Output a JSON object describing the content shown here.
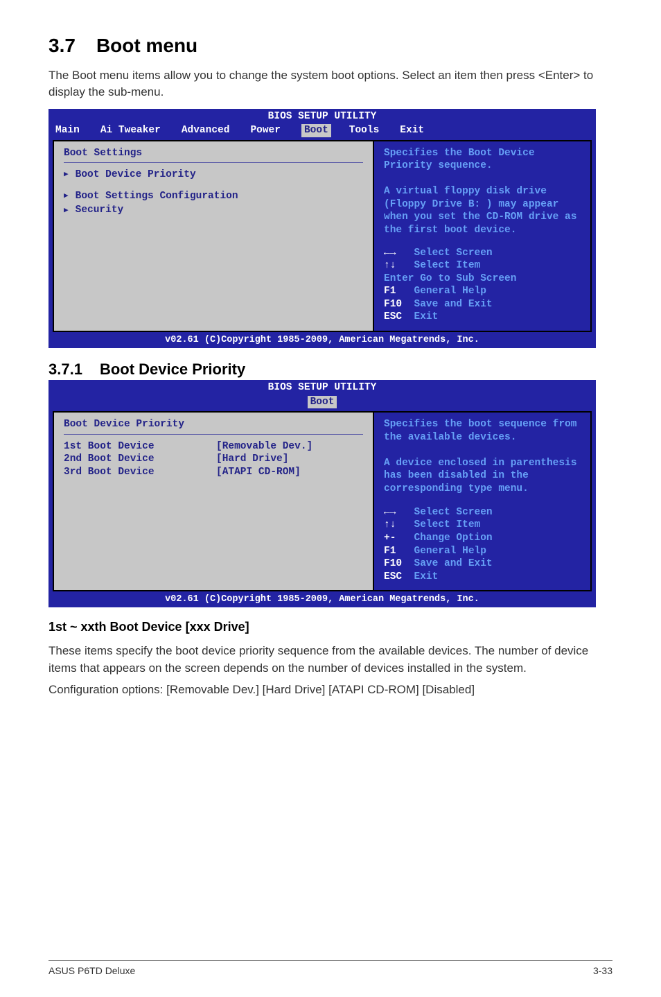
{
  "heading": {
    "num": "3.7",
    "title": "Boot menu"
  },
  "intro": "The Boot menu items allow you to change the system boot options. Select an item then press <Enter> to display the sub-menu.",
  "bios1": {
    "title": "BIOS SETUP UTILITY",
    "menubar": [
      "Main",
      "Ai Tweaker",
      "Advanced",
      "Power",
      "Boot",
      "Tools",
      "Exit"
    ],
    "active": 4,
    "panel_title": "Boot Settings",
    "items": [
      "Boot Device Priority",
      "Boot Settings Configuration",
      "Security"
    ],
    "help": "Specifies the Boot Device Priority sequence.\n\nA virtual floppy disk drive (Floppy Drive B: ) may appear when you set the CD-ROM drive as the first boot device.",
    "legend": {
      "arrows": "Select Screen",
      "updown": "Select Item",
      "enter": "Enter Go to Sub Screen",
      "f1": {
        "key": "F1",
        "label": "General Help"
      },
      "f10": {
        "key": "F10",
        "label": "Save and Exit"
      },
      "esc": {
        "key": "ESC",
        "label": "Exit"
      }
    },
    "footer": "v02.61 (C)Copyright 1985-2009, American Megatrends, Inc."
  },
  "subheading": {
    "num": "3.7.1",
    "title": "Boot Device Priority"
  },
  "bios2": {
    "title": "BIOS SETUP UTILITY",
    "active_tab": "Boot",
    "panel_title": "Boot Device Priority",
    "rows": [
      {
        "label": "1st Boot Device",
        "value": "[Removable Dev.]"
      },
      {
        "label": "2nd Boot Device",
        "value": "[Hard Drive]"
      },
      {
        "label": "3rd Boot Device",
        "value": "[ATAPI CD-ROM]"
      }
    ],
    "help": "Specifies the boot sequence from the available devices.\n\nA device enclosed in parenthesis has been disabled in the corresponding type menu.",
    "legend": {
      "arrows": "Select Screen",
      "updown": "Select Item",
      "plusminus": {
        "key": "+-",
        "label": "Change Option"
      },
      "f1": {
        "key": "F1",
        "label": "General Help"
      },
      "f10": {
        "key": "F10",
        "label": "Save and Exit"
      },
      "esc": {
        "key": "ESC",
        "label": "Exit"
      }
    },
    "footer": "v02.61 (C)Copyright 1985-2009, American Megatrends, Inc."
  },
  "subsection_title": "1st ~ xxth Boot Device [xxx Drive]",
  "body1": "These items specify the boot device priority sequence from the available devices. The number of device items that appears on the screen depends on the number of devices installed in the system.",
  "body2": "Configuration options: [Removable Dev.] [Hard Drive] [ATAPI CD-ROM] [Disabled]",
  "footer": {
    "left": "ASUS P6TD Deluxe",
    "right": "3-33"
  }
}
